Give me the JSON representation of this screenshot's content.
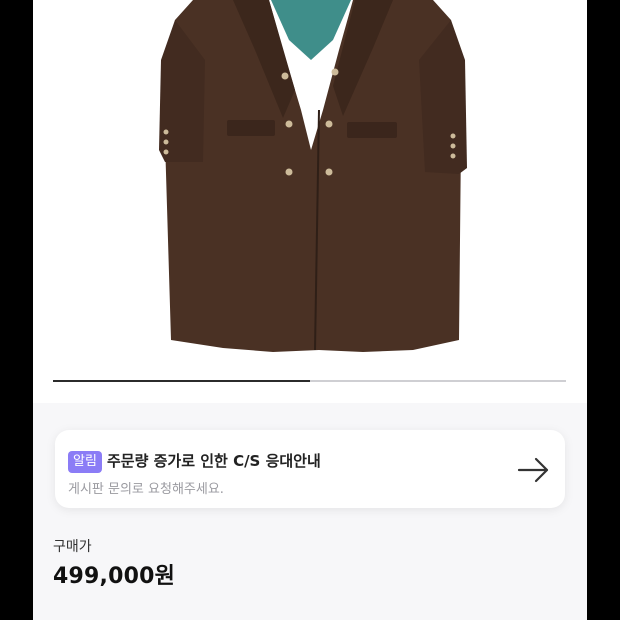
{
  "product": {
    "image_icon": "coat-image",
    "carousel_progress_fraction": 0.5
  },
  "notice": {
    "badge": "알림",
    "title": "주문량 증가로 인한 C/S 응대안내",
    "subtitle": "게시판 문의로 요청해주세요.",
    "icon": "arrow-right-icon"
  },
  "price": {
    "label": "구매가",
    "value": "499,000원"
  },
  "colors": {
    "badge": "#8b7cf6",
    "coat": "#4a3124"
  }
}
